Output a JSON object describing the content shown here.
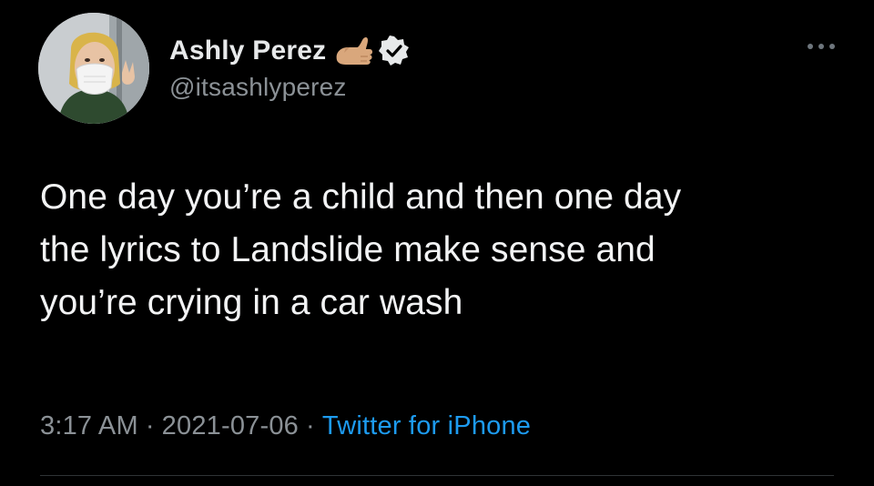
{
  "author": {
    "display_name": "Ashly Perez",
    "handle": "@itsashlyperez",
    "avatar_icon": "avatar",
    "badge_icons": [
      "hand-emoji-icon",
      "verified-badge-icon"
    ]
  },
  "tweet": {
    "text_lines": [
      "One day you’re a child and then one day",
      "the lyrics to Landslide make sense and",
      "you’re crying in a car wash"
    ],
    "time": "3:17 AM",
    "separator": "·",
    "date": "2021-07-06",
    "source": "Twitter for iPhone"
  },
  "menu": {
    "icon": "more-options-icon"
  },
  "colors": {
    "background": "#000000",
    "text": "#e7e9ea",
    "muted": "#8b9196",
    "link": "#1d9bf0"
  }
}
